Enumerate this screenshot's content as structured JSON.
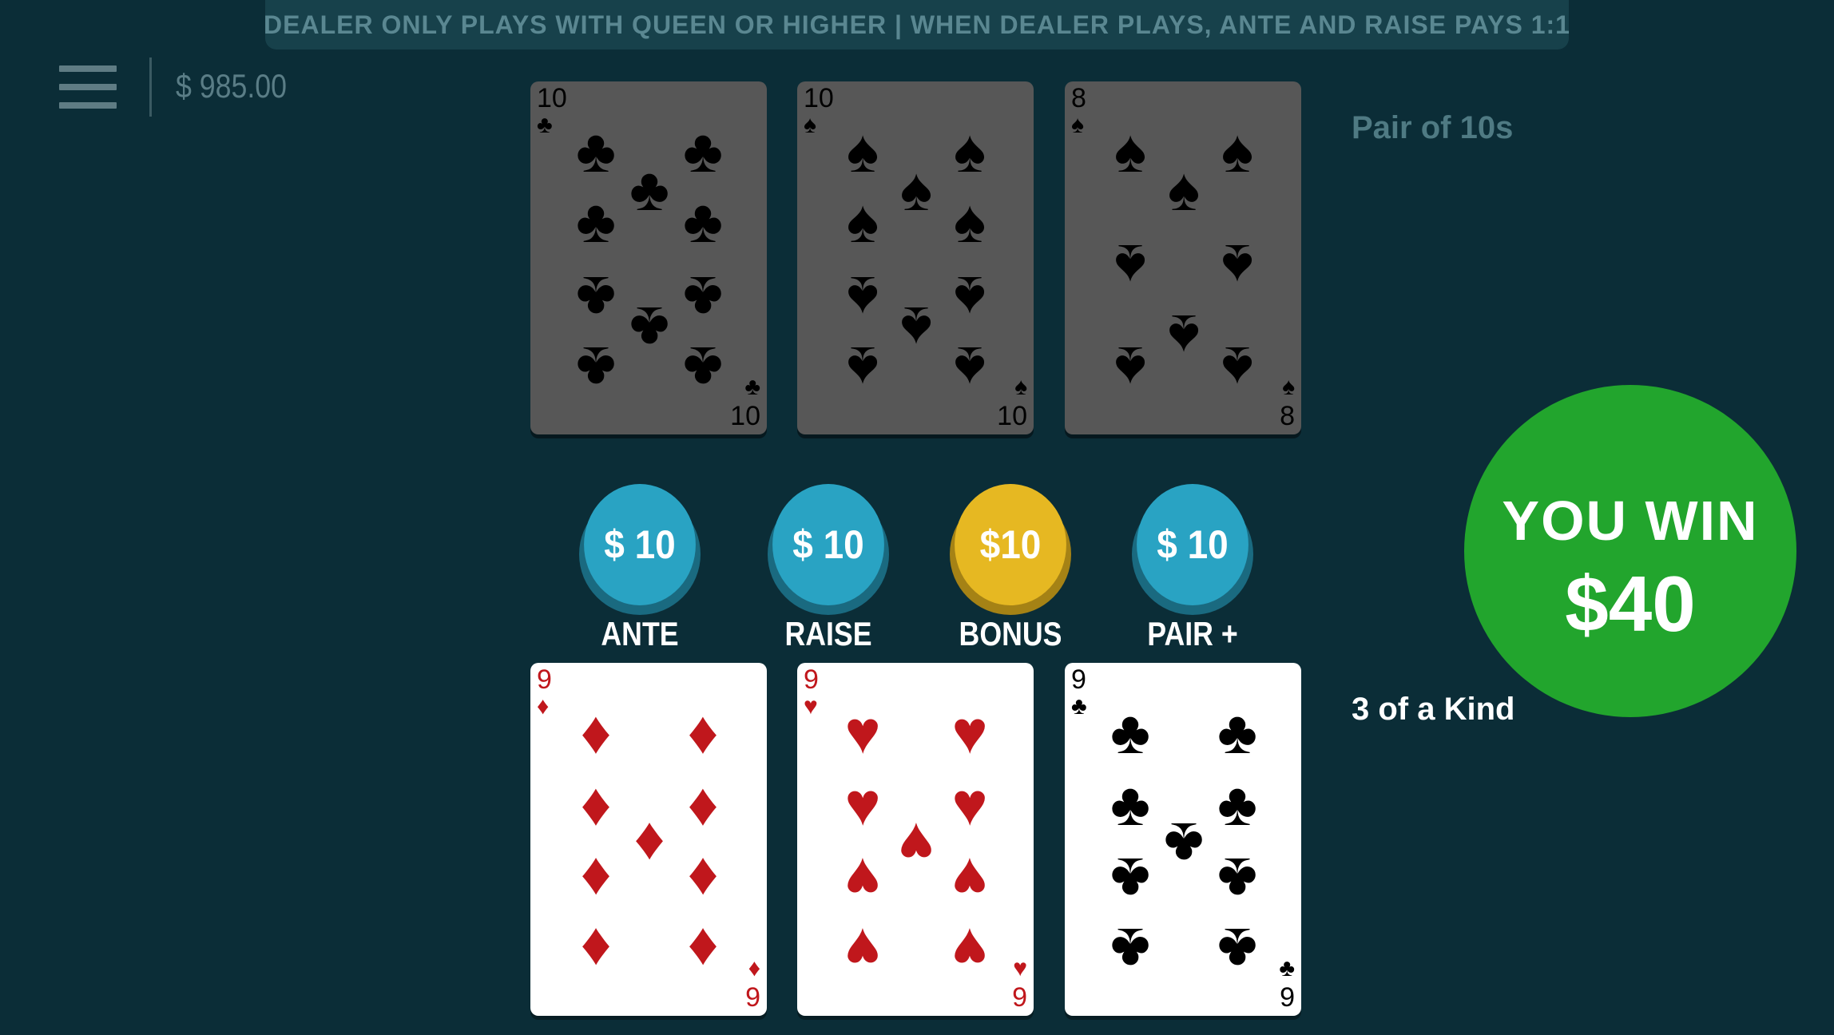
{
  "banner": "DEALER ONLY PLAYS WITH QUEEN OR HIGHER | WHEN DEALER PLAYS, ANTE AND RAISE PAYS 1:1",
  "balance": "$ 985.00",
  "dealer": {
    "hand_label": "Pair of 10s",
    "cards": [
      {
        "rank": "10",
        "suit": "♣"
      },
      {
        "rank": "10",
        "suit": "♠"
      },
      {
        "rank": "8",
        "suit": "♠"
      }
    ]
  },
  "player": {
    "hand_label": "3 of a Kind",
    "cards": [
      {
        "rank": "9",
        "suit": "♦"
      },
      {
        "rank": "9",
        "suit": "♥"
      },
      {
        "rank": "9",
        "suit": "♣"
      }
    ]
  },
  "bets": [
    {
      "amount": "$ 10",
      "label": "ANTE",
      "color": "#29a3c3"
    },
    {
      "amount": "$ 10",
      "label": "RAISE",
      "color": "#29a3c3"
    },
    {
      "amount": "$10",
      "label": "BONUS",
      "color": "#e6b822"
    },
    {
      "amount": "$ 10",
      "label": "PAIR +",
      "color": "#29a3c3"
    }
  ],
  "result": {
    "line1": "YOU WIN",
    "line2": "$40",
    "color": "#22a52d"
  },
  "colors": {
    "background": "#0b2d37",
    "red_suit": "#c0171c",
    "black_suit": "#000000"
  },
  "icons": {
    "menu": "hamburger-menu-icon"
  }
}
